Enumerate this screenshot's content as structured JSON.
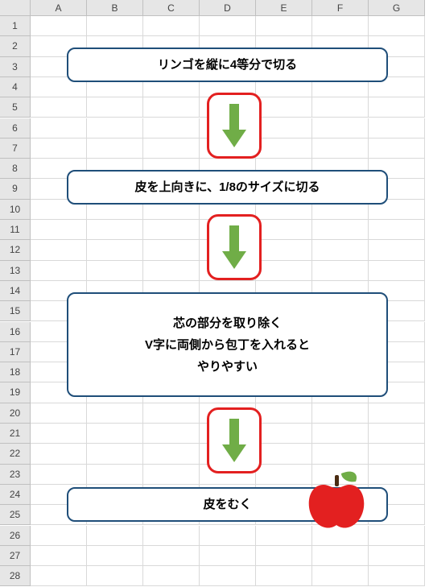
{
  "grid": {
    "columns": [
      "A",
      "B",
      "C",
      "D",
      "E",
      "F",
      "G"
    ],
    "rows_visible": 28
  },
  "steps": {
    "s1": "リンゴを縦に4等分で切る",
    "s2": "皮を上向きに、1/8のサイズに切る",
    "s3a": "芯の部分を取り除く",
    "s3b": "V字に両側から包丁を入れると",
    "s3c": "やりやすい",
    "s4": "皮をむく"
  },
  "icons": {
    "arrows": [
      1,
      2,
      3
    ],
    "apple": "apple-icon"
  },
  "colors": {
    "box_border": "#1f4e79",
    "arrow_border": "#e32020",
    "arrow_fill": "#70ad47",
    "apple": "#e32020",
    "leaf": "#70ad47"
  }
}
